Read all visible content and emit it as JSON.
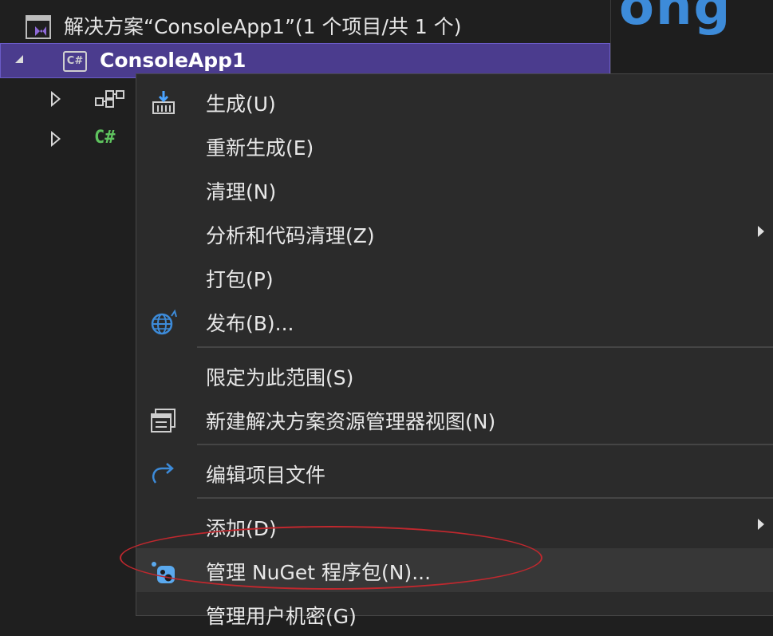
{
  "explorer": {
    "solution_label": "解决方案“ConsoleApp1”(1 个项目/共 1 个)",
    "project_label": "ConsoleApp1",
    "project_icon_text": "C#",
    "child_csharp_text": "C#"
  },
  "editor": {
    "partial_text": "ong"
  },
  "context_menu": {
    "items": [
      {
        "label": "生成(U)",
        "icon": "build-icon"
      },
      {
        "label": "重新生成(E)"
      },
      {
        "label": "清理(N)"
      },
      {
        "label": "分析和代码清理(Z)",
        "has_submenu": true
      },
      {
        "label": "打包(P)"
      },
      {
        "label": "发布(B)...",
        "icon": "globe-publish-icon"
      },
      {
        "label": "限定为此范围(S)"
      },
      {
        "label": "新建解决方案资源管理器视图(N)",
        "icon": "new-view-icon"
      },
      {
        "label": "编辑项目文件",
        "icon": "redo-arrow-icon"
      },
      {
        "label": "添加(D)",
        "has_submenu": true
      },
      {
        "label": "管理 NuGet 程序包(N)...",
        "icon": "nuget-icon"
      },
      {
        "label": "管理用户机密(G)"
      }
    ]
  },
  "colors": {
    "selection": "#4b3c8e",
    "annotation": "#c0282e",
    "accent_blue": "#3d8bd9"
  }
}
